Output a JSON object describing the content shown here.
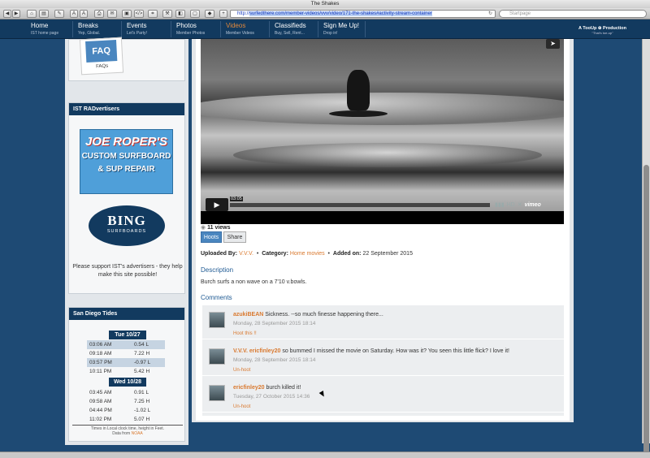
{
  "browser": {
    "title": "The Shakes",
    "url_prefix": "http://",
    "url_selected": "surfedthere.com/member-videos/vvv/video/171-the-shakes#activity-stream-container",
    "search_placeholder": "Startpage"
  },
  "nav": {
    "items": [
      {
        "label": "Home",
        "sub": "IST home page"
      },
      {
        "label": "Breaks",
        "sub": "Yep, Global."
      },
      {
        "label": "Events",
        "sub": "Let's Party!"
      },
      {
        "label": "Photos",
        "sub": "Member Photos"
      },
      {
        "label": "Videos",
        "sub": "Member Videos"
      },
      {
        "label": "Classifieds",
        "sub": "Buy, Sell, Rent..."
      },
      {
        "label": "Sign Me Up!",
        "sub": "Drop in!"
      }
    ],
    "brand_line1": "A TooUp ⊕ Production",
    "brand_line2": "\"That's toe-up\""
  },
  "sidebar": {
    "faq_text": "FAQ",
    "faq_sub": "FAQs",
    "advertisers_title": "IST RADvertisers",
    "joe_line1": "JOE ROPER'S",
    "joe_line2": "CUSTOM SURFBOARD",
    "joe_line3": "& SUP REPAIR",
    "bing_title": "BING",
    "bing_sub": "SURFBOARDS",
    "advertiser_note": "Please support IST's advertisers - they help make this site possible!",
    "tides_title": "San Diego Tides",
    "days": [
      {
        "label": "Tue 10/27",
        "rows": [
          {
            "time": "03:06 AM",
            "val": "0.54 L",
            "hl": true
          },
          {
            "time": "09:18 AM",
            "val": "7.22 H",
            "hl": false
          },
          {
            "time": "03:57 PM",
            "val": "-0.97 L",
            "hl": true
          },
          {
            "time": "10:11 PM",
            "val": "5.42 H",
            "hl": false
          }
        ]
      },
      {
        "label": "Wed 10/28",
        "rows": [
          {
            "time": "03:45 AM",
            "val": "0.91 L",
            "hl": false
          },
          {
            "time": "09:58 AM",
            "val": "7.25 H",
            "hl": false
          },
          {
            "time": "04:44 PM",
            "val": "-1.02 L",
            "hl": false
          },
          {
            "time": "11:02 PM",
            "val": "5.07 H",
            "hl": false
          }
        ]
      }
    ],
    "tides_note": "Times in Local clock time, height in Feet.",
    "tides_source_prefix": "Data from",
    "tides_source": "NOAA"
  },
  "video": {
    "time": "03:05",
    "brand": "vimeo",
    "hd": "HD",
    "views": "11 views",
    "hoots_label": "Hoots",
    "share_label": "Share",
    "uploaded_by_label": "Uploaded By:",
    "uploaded_by": "V.V.V.",
    "category_label": "Category:",
    "category": "Home movies",
    "added_label": "Added on:",
    "added_on": "22 September 2015",
    "description_heading": "Description",
    "description": "Burch surfs a non wave on a 7'10 v.bowls.",
    "comments_heading": "Comments"
  },
  "comments": [
    {
      "name": "azukiBEAN",
      "text": "Sickness. --so much finesse happening there...",
      "date": "Monday, 28 September 2015 18:14",
      "link": "Hoot this !!"
    },
    {
      "name": "V.V.V. ericfinley20",
      "text": "so bummed I missed the movie on Saturday. How was it? You seen this little flick? I love it!",
      "date": "Monday, 28 September 2015 18:14",
      "link": "Un-hoot"
    },
    {
      "name": "ericfinley20",
      "text": "burch killed it!",
      "date": "Tuesday, 27 October 2015 14:36",
      "link": "Un-hoot"
    }
  ]
}
